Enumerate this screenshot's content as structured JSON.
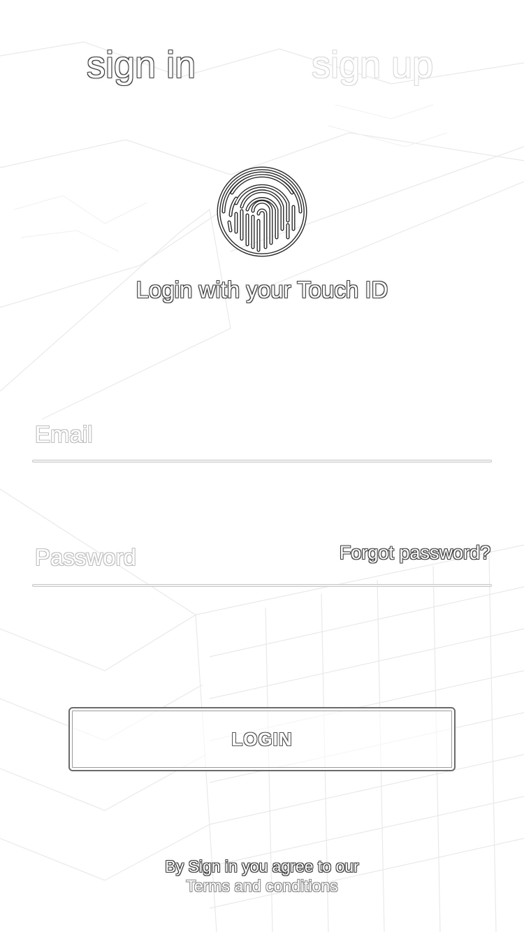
{
  "tabs": {
    "sign_in": "sign in",
    "sign_up": "sign up",
    "active": "sign_in"
  },
  "touch_id": {
    "icon": "fingerprint-icon",
    "label": "Login with your Touch ID"
  },
  "form": {
    "email": {
      "placeholder": "Email",
      "value": ""
    },
    "password": {
      "placeholder": "Password",
      "value": ""
    },
    "forgot_password": "Forgot password?",
    "login_label": "LOGIN"
  },
  "footer": {
    "agree_text": "By Sign in you agree to our",
    "terms_link": "Terms and conditions"
  }
}
